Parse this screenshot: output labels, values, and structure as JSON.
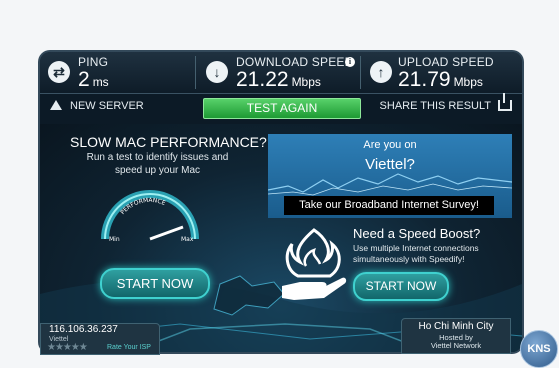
{
  "stats": {
    "ping": {
      "label": "PING",
      "value": "2",
      "unit": "ms",
      "icon": "ping-icon"
    },
    "download": {
      "label": "DOWNLOAD SPEED",
      "value": "21.22",
      "unit": "Mbps",
      "icon": "download-icon"
    },
    "upload": {
      "label": "UPLOAD SPEED",
      "value": "21.79",
      "unit": "Mbps",
      "icon": "upload-icon"
    }
  },
  "toolbar": {
    "new_server": "NEW SERVER",
    "test_again": "TEST AGAIN",
    "share": "SHARE THIS RESULT"
  },
  "mac_promo": {
    "title": "SLOW MAC PERFORMANCE?",
    "subtitle": "Run a test to identify issues and speed up your Mac",
    "gauge_label": "PERFORMANCE",
    "gauge_min": "Min",
    "gauge_max": "Max",
    "button": "START NOW"
  },
  "isp_promo": {
    "line1": "Are you on",
    "line2": "Viettel?",
    "survey": "Take our Broadband Internet Survey!"
  },
  "boost_promo": {
    "title": "Need a Speed Boost?",
    "subtitle": "Use multiple Internet connections simultaneously with Speedify!",
    "button": "START NOW"
  },
  "client": {
    "ip": "116.106.36.237",
    "isp": "Viettel",
    "rate": "Rate Your ISP"
  },
  "server": {
    "city": "Ho Chi Minh City",
    "hosted_by": "Hosted by",
    "host": "Viettel Network"
  },
  "watermark": "KNS",
  "colors": {
    "accent_green": "#1d9a33",
    "accent_teal": "#3fd1cf",
    "panel_dark": "#0c1a26",
    "promo_blue": "#2e7fb7"
  }
}
